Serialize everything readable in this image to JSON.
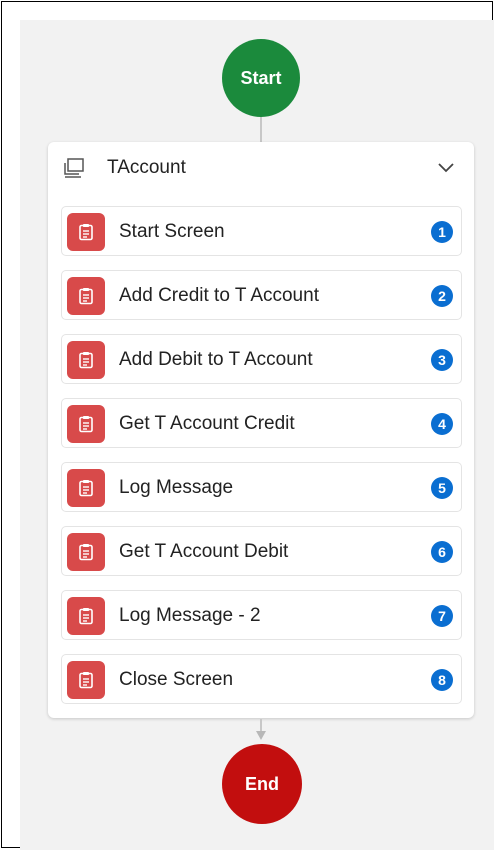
{
  "flow": {
    "start_label": "Start",
    "end_label": "End",
    "colors": {
      "start": "#1b8a3c",
      "end": "#c20e0e",
      "step_icon": "#d84a4a",
      "badge": "#0a6ed1"
    }
  },
  "group": {
    "title": "TAccount",
    "icon": "screen-group-icon",
    "expanded": true,
    "steps": [
      {
        "label": "Start Screen",
        "number": "1",
        "icon": "clipboard-icon"
      },
      {
        "label": "Add Credit to T Account",
        "number": "2",
        "icon": "clipboard-icon"
      },
      {
        "label": "Add Debit to T Account",
        "number": "3",
        "icon": "clipboard-icon"
      },
      {
        "label": "Get T Account Credit",
        "number": "4",
        "icon": "clipboard-icon"
      },
      {
        "label": "Log Message",
        "number": "5",
        "icon": "clipboard-icon"
      },
      {
        "label": "Get T Account Debit",
        "number": "6",
        "icon": "clipboard-icon"
      },
      {
        "label": "Log Message - 2",
        "number": "7",
        "icon": "clipboard-icon"
      },
      {
        "label": "Close Screen",
        "number": "8",
        "icon": "clipboard-icon"
      }
    ]
  }
}
